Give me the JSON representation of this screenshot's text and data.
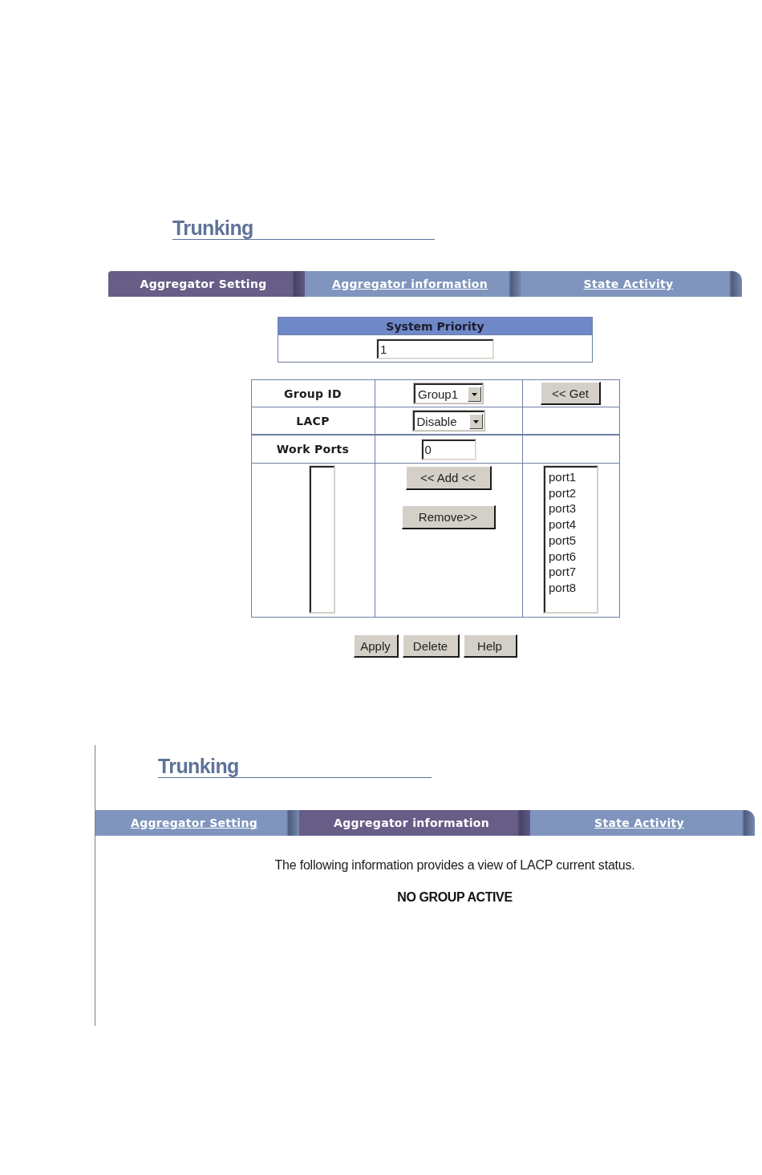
{
  "setting_page": {
    "title": "Trunking",
    "tabs": [
      {
        "label": "Aggregator Setting",
        "selected": true
      },
      {
        "label": "Aggregator information",
        "selected": false
      },
      {
        "label": "State Activity",
        "selected": false
      }
    ],
    "system_priority": {
      "label": "System Priority",
      "value": "1"
    },
    "rows": [
      {
        "label": "Group ID",
        "kind": "select",
        "value": "Group1",
        "button": "<< Get"
      },
      {
        "label": "LACP",
        "kind": "select",
        "value": "Disable"
      },
      {
        "label": "Work Ports",
        "kind": "input",
        "value": "0"
      }
    ],
    "add_button": "<< Add <<",
    "remove_button": "Remove>>",
    "available_ports": [
      "port1",
      "port2",
      "port3",
      "port4",
      "port5",
      "port6",
      "port7",
      "port8"
    ],
    "buttons": [
      "Apply",
      "Delete",
      "Help"
    ]
  },
  "info_page": {
    "title": "Trunking",
    "tabs": [
      {
        "label": "Aggregator Setting",
        "selected": false
      },
      {
        "label": "Aggregator information",
        "selected": true
      },
      {
        "label": "State Activity",
        "selected": false
      }
    ],
    "description": "The following information provides a view of LACP current status.",
    "status": "NO GROUP ACTIVE"
  }
}
